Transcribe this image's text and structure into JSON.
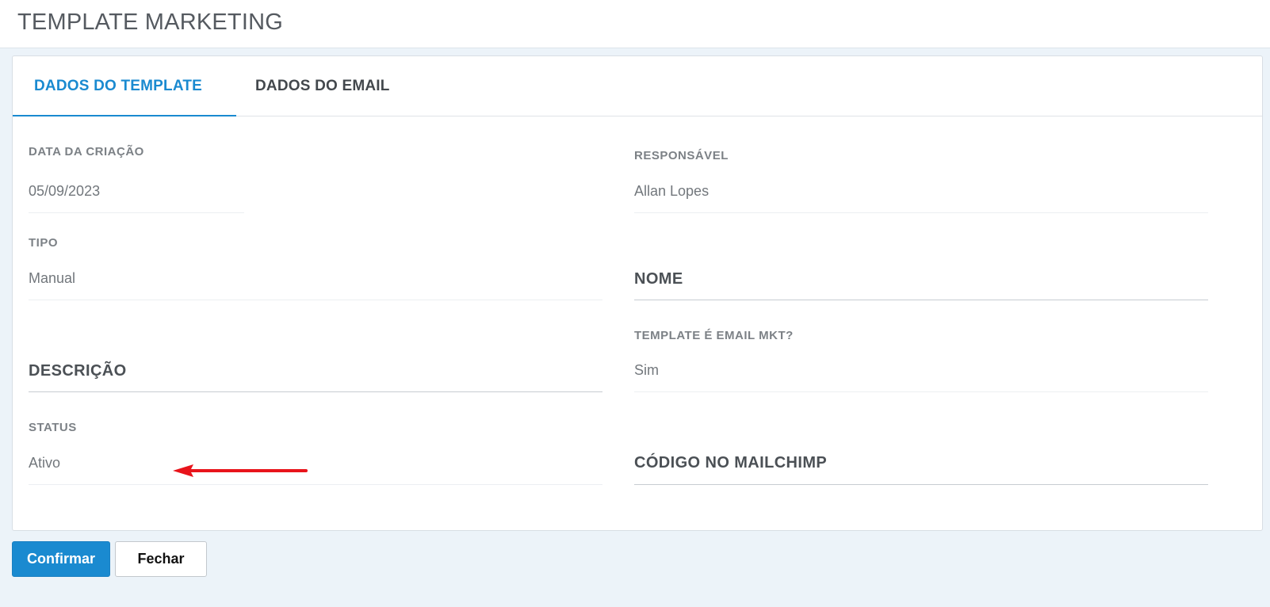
{
  "page": {
    "title": "TEMPLATE MARKETING"
  },
  "tabs": [
    {
      "label": "DADOS DO TEMPLATE",
      "active": true
    },
    {
      "label": "DADOS DO EMAIL",
      "active": false
    }
  ],
  "fields": {
    "data_criacao": {
      "label": "DATA DA CRIAÇÃO",
      "value": "05/09/2023"
    },
    "responsavel": {
      "label": "RESPONSÁVEL",
      "value": "Allan Lopes"
    },
    "tipo": {
      "label": "TIPO",
      "value": "Manual"
    },
    "nome": {
      "label": "NOME"
    },
    "template_email_mkt": {
      "label": "TEMPLATE É EMAIL MKT?",
      "value": "Sim"
    },
    "descricao": {
      "label": "DESCRIÇÃO"
    },
    "status": {
      "label": "STATUS",
      "value": "Ativo"
    },
    "codigo_mailchimp": {
      "label": "CÓDIGO NO MAILCHIMP"
    }
  },
  "annotation": {
    "arrow_color": "#e8141b"
  },
  "buttons": {
    "confirm": "Confirmar",
    "close": "Fechar"
  },
  "colors": {
    "accent": "#1a8ad0",
    "background": "#ecf3f9"
  }
}
